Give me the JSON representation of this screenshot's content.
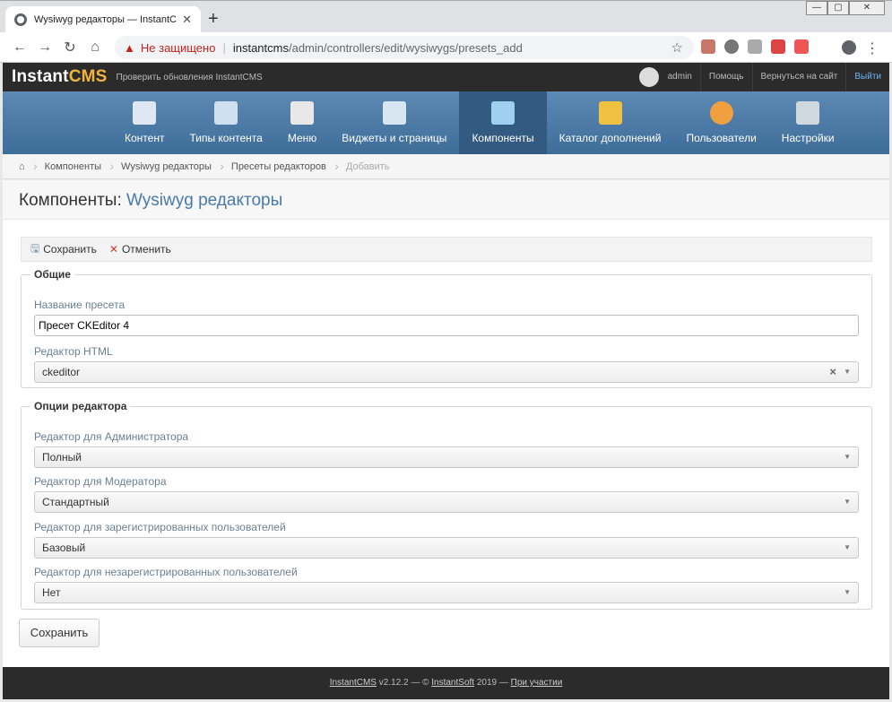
{
  "browser": {
    "tab_title": "Wysiwyg редакторы — InstantCMS",
    "new_tab": "+",
    "address": {
      "warning": "Не защищено",
      "host": "instantcms",
      "path": "/admin/controllers/edit/wysiwygs/presets_add"
    }
  },
  "cms": {
    "logo_a": "Instant",
    "logo_b": "CMS",
    "update_link": "Проверить обновления InstantCMS",
    "user": "admin",
    "help": "Помощь",
    "back_to_site": "Вернуться на сайт",
    "logout": "Выйти"
  },
  "nav": [
    {
      "label": "Контент",
      "color": "#dfe8f2"
    },
    {
      "label": "Типы контента",
      "color": "#cfe0f0"
    },
    {
      "label": "Меню",
      "color": "#e8e8e8"
    },
    {
      "label": "Виджеты и страницы",
      "color": "#d8e6f2"
    },
    {
      "label": "Компоненты",
      "color": "#9fd0f0"
    },
    {
      "label": "Каталог дополнений",
      "color": "#f0c040"
    },
    {
      "label": "Пользователи",
      "color": "#f0a040"
    },
    {
      "label": "Настройки",
      "color": "#d0d8e0"
    }
  ],
  "breadcrumbs": [
    "Компоненты",
    "Wysiwyg редакторы",
    "Пресеты редакторов",
    "Добавить"
  ],
  "page": {
    "title": "Компоненты:",
    "subtitle": "Wysiwyg редакторы"
  },
  "actions": {
    "save": "Сохранить",
    "cancel": "Отменить"
  },
  "group_general": {
    "legend": "Общие",
    "preset_name_label": "Название пресета",
    "preset_name_value": "Пресет CKEditor 4",
    "editor_label": "Редактор HTML",
    "editor_value": "ckeditor"
  },
  "group_options": {
    "legend": "Опции редактора",
    "admin_label": "Редактор для Администратора",
    "admin_value": "Полный",
    "moder_label": "Редактор для Модератора",
    "moder_value": "Стандартный",
    "reg_label": "Редактор для зарегистрированных пользователей",
    "reg_value": "Базовый",
    "guest_label": "Редактор для незарегистрированных пользователей",
    "guest_value": "Нет"
  },
  "submit_label": "Сохранить",
  "footer": {
    "product": "InstantCMS",
    "version": " v2.12.2 — © ",
    "company": "InstantSoft",
    "year": " 2019 — ",
    "support": "При участии"
  }
}
